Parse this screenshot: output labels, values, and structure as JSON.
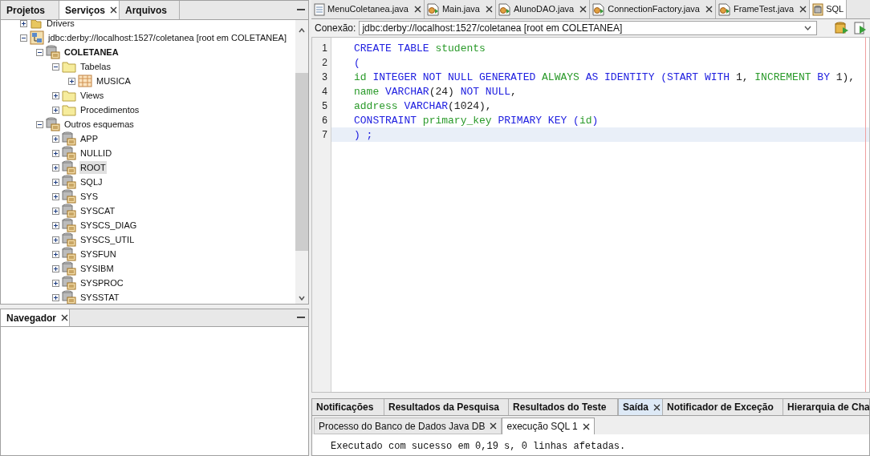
{
  "left_tabs": [
    {
      "label": "Projetos",
      "selected": false,
      "closable": false
    },
    {
      "label": "Serviços",
      "selected": true,
      "closable": true
    },
    {
      "label": "Arquivos",
      "selected": false,
      "closable": false
    }
  ],
  "tree": [
    {
      "label": "Drivers",
      "kind": "drivers",
      "expanded": false,
      "bold": false,
      "selected": false
    },
    {
      "label": "jdbc:derby://localhost:1527/coletanea [root em COLETANEA]",
      "kind": "connection",
      "expanded": true,
      "bold": false,
      "selected": false,
      "children": [
        {
          "label": "COLETANEA",
          "kind": "schema",
          "expanded": true,
          "bold": true,
          "selected": false,
          "children": [
            {
              "label": "Tabelas",
              "kind": "folder",
              "expanded": true,
              "bold": false,
              "selected": false,
              "children": [
                {
                  "label": "MUSICA",
                  "kind": "table",
                  "expanded": false,
                  "bold": false,
                  "selected": false
                }
              ]
            },
            {
              "label": "Views",
              "kind": "folder",
              "expanded": false,
              "bold": false,
              "selected": false
            },
            {
              "label": "Procedimentos",
              "kind": "folder",
              "expanded": false,
              "bold": false,
              "selected": false
            }
          ]
        },
        {
          "label": "Outros esquemas",
          "kind": "schema",
          "expanded": true,
          "bold": false,
          "selected": false,
          "children": [
            {
              "label": "APP",
              "kind": "schema",
              "expanded": false,
              "bold": false,
              "selected": false
            },
            {
              "label": "NULLID",
              "kind": "schema",
              "expanded": false,
              "bold": false,
              "selected": false
            },
            {
              "label": "ROOT",
              "kind": "schema",
              "expanded": false,
              "bold": false,
              "selected": true
            },
            {
              "label": "SQLJ",
              "kind": "schema",
              "expanded": false,
              "bold": false,
              "selected": false
            },
            {
              "label": "SYS",
              "kind": "schema",
              "expanded": false,
              "bold": false,
              "selected": false
            },
            {
              "label": "SYSCAT",
              "kind": "schema",
              "expanded": false,
              "bold": false,
              "selected": false
            },
            {
              "label": "SYSCS_DIAG",
              "kind": "schema",
              "expanded": false,
              "bold": false,
              "selected": false
            },
            {
              "label": "SYSCS_UTIL",
              "kind": "schema",
              "expanded": false,
              "bold": false,
              "selected": false
            },
            {
              "label": "SYSFUN",
              "kind": "schema",
              "expanded": false,
              "bold": false,
              "selected": false
            },
            {
              "label": "SYSIBM",
              "kind": "schema",
              "expanded": false,
              "bold": false,
              "selected": false
            },
            {
              "label": "SYSPROC",
              "kind": "schema",
              "expanded": false,
              "bold": false,
              "selected": false
            },
            {
              "label": "SYSSTAT",
              "kind": "schema",
              "expanded": false,
              "bold": false,
              "selected": false
            }
          ]
        }
      ]
    }
  ],
  "navigator": {
    "label": "Navegador",
    "closable": true
  },
  "editor_tabs": [
    {
      "label": "MenuColetanea.java",
      "kind": "form",
      "selected": false
    },
    {
      "label": "Main.java",
      "kind": "class",
      "selected": false
    },
    {
      "label": "AlunoDAO.java",
      "kind": "class",
      "selected": false
    },
    {
      "label": "ConnectionFactory.java",
      "kind": "class",
      "selected": false
    },
    {
      "label": "FrameTest.java",
      "kind": "class",
      "selected": false
    },
    {
      "label": "SQL",
      "kind": "sql",
      "selected": true
    }
  ],
  "connection": {
    "label": "Conexão:",
    "value": "jdbc:derby://localhost:1527/coletanea [root em COLETANEA]"
  },
  "code": [
    {
      "number": "1",
      "current": false,
      "tokens": [
        {
          "kind": "keyword",
          "text": "CREATE TABLE "
        },
        {
          "kind": "identifier",
          "text": "students"
        }
      ]
    },
    {
      "number": "2",
      "current": false,
      "tokens": [
        {
          "kind": "keyword",
          "text": "("
        }
      ]
    },
    {
      "number": "3",
      "current": false,
      "tokens": [
        {
          "kind": "identifier",
          "text": "id"
        },
        {
          "kind": "keyword",
          "text": " INTEGER NOT NULL GENERATED "
        },
        {
          "kind": "identifier",
          "text": "ALWAYS"
        },
        {
          "kind": "keyword",
          "text": " AS IDENTITY (START WITH "
        },
        {
          "kind": "plain",
          "text": "1, "
        },
        {
          "kind": "identifier",
          "text": "INCREMENT"
        },
        {
          "kind": "keyword",
          "text": " BY "
        },
        {
          "kind": "plain",
          "text": "1),"
        }
      ]
    },
    {
      "number": "4",
      "current": false,
      "tokens": [
        {
          "kind": "identifier",
          "text": "name"
        },
        {
          "kind": "keyword",
          "text": " VARCHAR"
        },
        {
          "kind": "plain",
          "text": "(24) "
        },
        {
          "kind": "keyword",
          "text": "NOT NULL"
        },
        {
          "kind": "plain",
          "text": ","
        }
      ]
    },
    {
      "number": "5",
      "current": false,
      "tokens": [
        {
          "kind": "identifier",
          "text": "address"
        },
        {
          "kind": "keyword",
          "text": " VARCHAR"
        },
        {
          "kind": "plain",
          "text": "(1024),"
        }
      ]
    },
    {
      "number": "6",
      "current": false,
      "tokens": [
        {
          "kind": "keyword",
          "text": "CONSTRAINT "
        },
        {
          "kind": "identifier",
          "text": "primary_key"
        },
        {
          "kind": "keyword",
          "text": " PRIMARY KEY ("
        },
        {
          "kind": "identifier",
          "text": "id"
        },
        {
          "kind": "keyword",
          "text": ")"
        }
      ]
    },
    {
      "number": "7",
      "current": true,
      "tokens": [
        {
          "kind": "keyword",
          "text": ") ;"
        }
      ]
    }
  ],
  "output_tabs": [
    {
      "label": "Notificações",
      "selected": false,
      "closable": false
    },
    {
      "label": "Resultados da Pesquisa",
      "selected": false,
      "closable": false
    },
    {
      "label": "Resultados do Teste",
      "selected": false,
      "closable": false
    },
    {
      "label": "Saída",
      "selected": true,
      "closable": true
    },
    {
      "label": "Notificador de Exceção",
      "selected": false,
      "closable": false
    },
    {
      "label": "Hierarquia de Cha",
      "selected": false,
      "closable": false
    }
  ],
  "output_subtabs": [
    {
      "label": "Processo do Banco de Dados Java DB",
      "selected": false
    },
    {
      "label": "execução SQL 1",
      "selected": true
    }
  ],
  "output_text": "Executado com sucesso em 0,19 s, 0 linhas afetadas."
}
